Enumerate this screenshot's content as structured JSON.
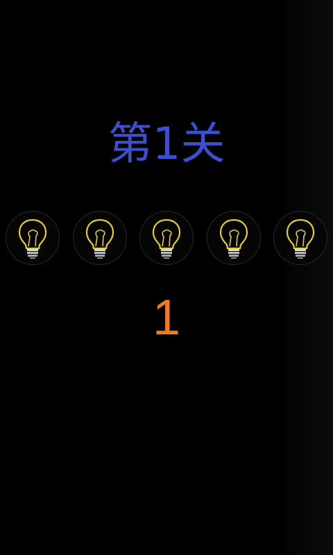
{
  "level": {
    "title": "第1关",
    "title_color": "#3b4fd0"
  },
  "bulbs": {
    "count": 5,
    "icon": "lightbulb-icon",
    "color": "#e8d020"
  },
  "counter": {
    "value": "1",
    "color": "#f07a22"
  }
}
